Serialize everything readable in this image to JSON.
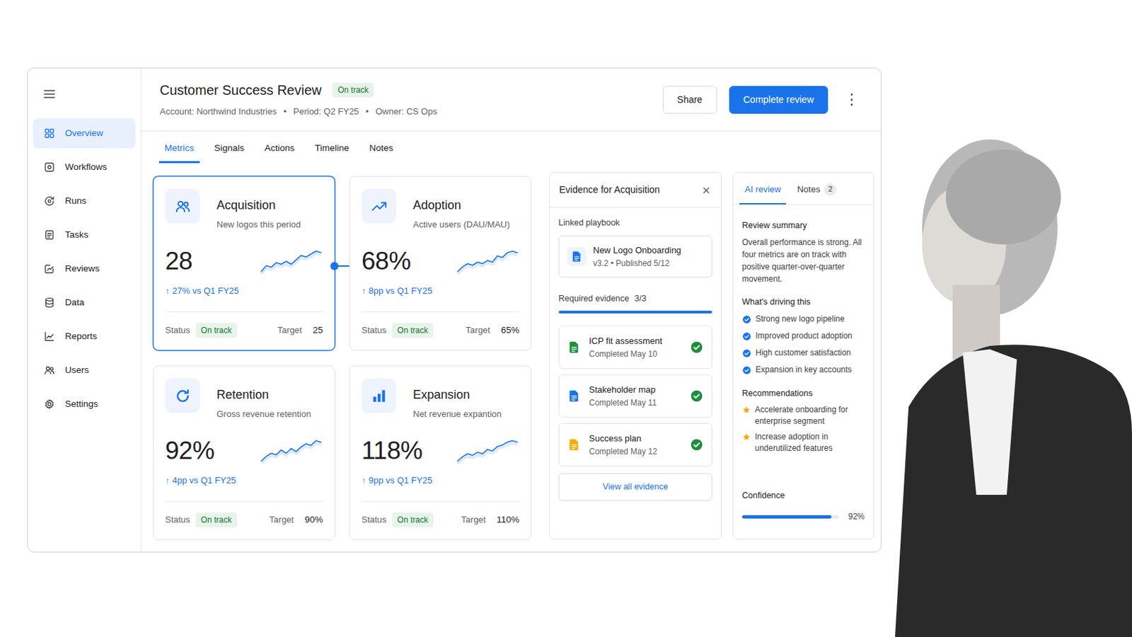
{
  "sidebar": {
    "items": [
      {
        "label": "Overview",
        "selected": true
      },
      {
        "label": "Workflows",
        "selected": false
      },
      {
        "label": "Runs",
        "selected": false
      },
      {
        "label": "Tasks",
        "selected": false
      },
      {
        "label": "Reviews",
        "selected": false
      },
      {
        "label": "Data",
        "selected": false
      },
      {
        "label": "Reports",
        "selected": false
      },
      {
        "label": "Users",
        "selected": false
      },
      {
        "label": "Settings",
        "selected": false
      }
    ]
  },
  "header": {
    "title": "Customer Success Review",
    "status": "On track",
    "meta": [
      "Account: Northwind Industries",
      "Period: Q2 FY25",
      "Owner: CS Ops"
    ],
    "separator": "•",
    "share": "Share",
    "complete": "Complete review",
    "more": "⋮"
  },
  "tabs": [
    {
      "label": "Metrics",
      "selected": true
    },
    {
      "label": "Signals",
      "selected": false
    },
    {
      "label": "Actions",
      "selected": false
    },
    {
      "label": "Timeline",
      "selected": false
    },
    {
      "label": "Notes",
      "selected": false
    }
  ],
  "metrics": [
    {
      "title": "Acquisition",
      "subtitle": "New logos this period",
      "value": "28",
      "arrow": "↑",
      "delta": "27% vs Q1 FY25",
      "status_label": "Status",
      "status": "On track",
      "target_label": "Target",
      "target": "25",
      "selected": true,
      "spark": [
        10,
        14,
        13,
        16,
        15,
        17,
        15,
        18,
        21,
        20,
        22,
        24,
        23
      ]
    },
    {
      "title": "Adoption",
      "subtitle": "Active users (DAU/MAU)",
      "value": "68%",
      "arrow": "↑",
      "delta": "8pp vs Q1 FY25",
      "status_label": "Status",
      "status": "On track",
      "target_label": "Target",
      "target": "65%",
      "selected": false,
      "spark": [
        10,
        13,
        15,
        14,
        16,
        15,
        17,
        16,
        20,
        19,
        22,
        23,
        22
      ]
    },
    {
      "title": "Retention",
      "subtitle": "Gross revenue retention",
      "value": "92%",
      "arrow": "↑",
      "delta": "4pp vs Q1 FY25",
      "status_label": "Status",
      "status": "On track",
      "target_label": "Target",
      "target": "90%",
      "selected": false,
      "spark": [
        10,
        13,
        15,
        14,
        17,
        15,
        18,
        16,
        19,
        21,
        20,
        23,
        22
      ]
    },
    {
      "title": "Expansion",
      "subtitle": "Net revenue expantion",
      "value": "118%",
      "arrow": "↑",
      "delta": "9pp vs Q1 FY25",
      "status_label": "Status",
      "status": "On track",
      "target_label": "Target",
      "target": "110%",
      "selected": false,
      "spark": [
        10,
        13,
        15,
        14,
        16,
        15,
        18,
        17,
        20,
        21,
        23,
        24,
        23
      ]
    }
  ],
  "evidence": {
    "title": "Evidence for Acquisition",
    "close": "×",
    "playbook_label": "Linked playbook",
    "playbook": {
      "name": "New Logo Onboarding",
      "meta": "v3.2 • Published 5/12"
    },
    "required_label": "Required evidence",
    "required_count": "3/3",
    "level": 1,
    "items": [
      {
        "name": "ICP fit assessment",
        "meta": "Completed May 10",
        "color": "#1e8e3e",
        "done": true
      },
      {
        "name": "Stakeholder map",
        "meta": "Completed May 11",
        "color": "#1a73e8",
        "done": true
      },
      {
        "name": "Success plan",
        "meta": "Completed May 12",
        "color": "#f9ab00",
        "done": true
      }
    ],
    "view_all": "View all evidence"
  },
  "ai_panel": {
    "tabs": [
      {
        "label": "AI review",
        "selected": true,
        "count": ""
      },
      {
        "label": "Notes",
        "selected": false,
        "count": "2"
      }
    ],
    "summary_title": "Review summary",
    "summary": "Overall performance is strong. All four metrics are on track with positive quarter-over-quarter movement.",
    "drivers_title": "What's driving this",
    "drivers": [
      {
        "label": "Strong new logo pipeline",
        "checked": true
      },
      {
        "label": "Improved product adoption",
        "checked": true
      },
      {
        "label": "High customer satisfaction",
        "checked": true
      },
      {
        "label": "Expansion in key accounts",
        "checked": true
      }
    ],
    "recommendations_title": "Recommendations",
    "recommendations": [
      {
        "label": "Accelerate onboarding for enterprise segment"
      },
      {
        "label": "Increase adoption in underutilized features"
      }
    ],
    "confidence_label": "Confidence",
    "confidence": "92%",
    "confidence_level": 0.92
  }
}
